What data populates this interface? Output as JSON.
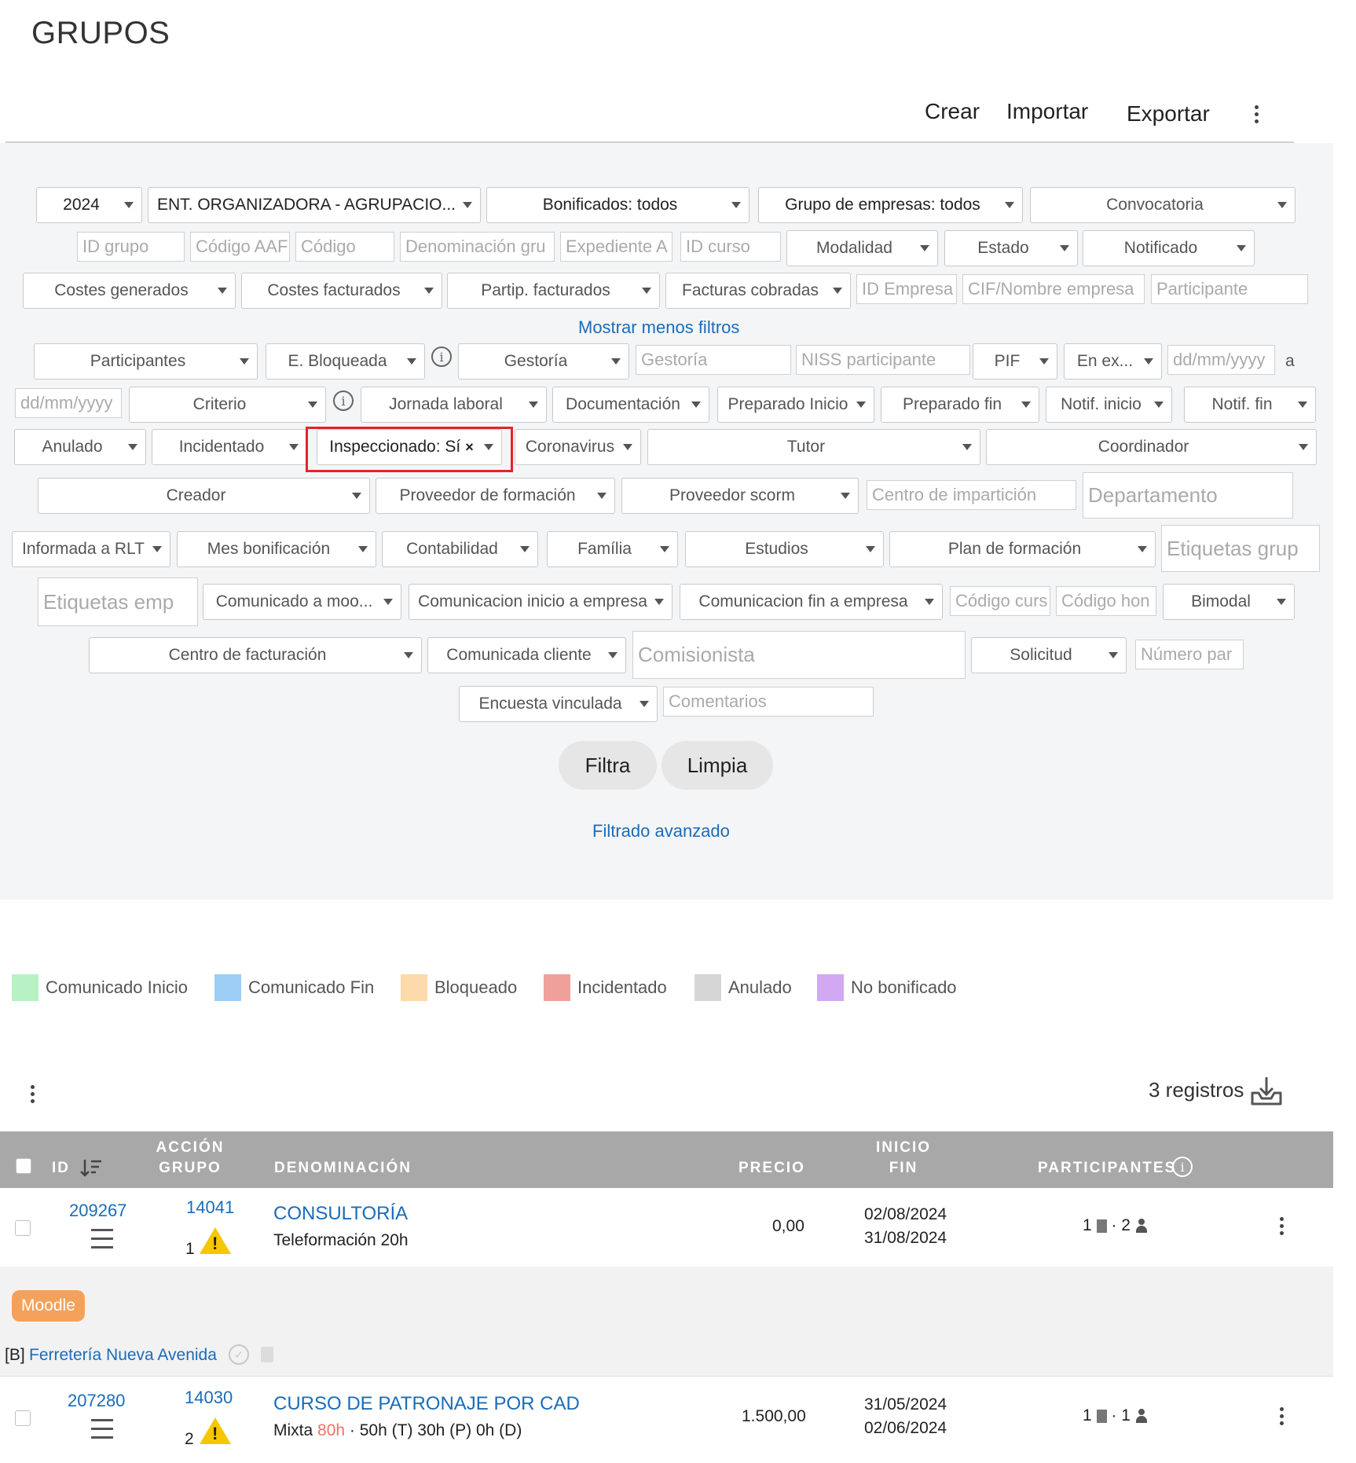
{
  "page": {
    "title": "GRUPOS"
  },
  "toolbar": {
    "create": "Crear",
    "import": "Importar",
    "export": "Exportar"
  },
  "filters": {
    "year": "2024",
    "entity": "ENT. ORGANIZADORA - AGRUPACIO...",
    "bonificados": "Bonificados: todos",
    "grupo_empresas": "Grupo de empresas: todos",
    "convocatoria": "Convocatoria",
    "id_grupo": "ID grupo",
    "codigo_aaf": "Código AAF",
    "codigo": "Código",
    "denominacion": "Denominación gru",
    "expediente": "Expediente A",
    "id_curso": "ID curso",
    "modalidad": "Modalidad",
    "estado": "Estado",
    "notificado": "Notificado",
    "costes_generados": "Costes generados",
    "costes_facturados": "Costes facturados",
    "partip_facturados": "Partip. facturados",
    "facturas_cobradas": "Facturas cobradas",
    "id_empresa": "ID Empresa",
    "cif_nombre": "CIF/Nombre empresa",
    "participante": "Participante",
    "mostrar_menos": "Mostrar menos filtros",
    "participantes": "Participantes",
    "e_bloqueada": "E. Bloqueada",
    "gestoria_select": "Gestoría",
    "gestoria_input": "Gestoría",
    "niss": "NISS participante",
    "pif": "PIF",
    "en_ex": "En ex...",
    "date_from": "dd/mm/yyyy",
    "a": "a",
    "date_to": "dd/mm/yyyy",
    "criterio": "Criterio",
    "jornada": "Jornada laboral",
    "documentacion": "Documentación",
    "preparado_inicio": "Preparado Inicio",
    "preparado_fin": "Preparado fin",
    "notif_inicio": "Notif. inicio",
    "notif_fin": "Notif. fin",
    "anulado": "Anulado",
    "incidentado": "Incidentado",
    "inspeccionado": "Inspeccionado: Sí",
    "clear": "×",
    "coronavirus": "Coronavirus",
    "tutor": "Tutor",
    "coordinador": "Coordinador",
    "creador": "Creador",
    "proveedor_formacion": "Proveedor de formación",
    "proveedor_scorm": "Proveedor scorm",
    "centro_imparticion": "Centro de impartición",
    "departamento": "Departamento",
    "informada_rlt": "Informada a RLT",
    "mes_bonificacion": "Mes bonificación",
    "contabilidad": "Contabilidad",
    "familia": "Família",
    "estudios": "Estudios",
    "plan_formacion": "Plan de formación",
    "etiquetas_grupo": "Etiquetas grup",
    "etiquetas_emp": "Etiquetas emp",
    "comunicado_moo": "Comunicado a moo...",
    "com_inicio_empresa": "Comunicacion inicio a empresa",
    "com_fin_empresa": "Comunicacion fin a empresa",
    "codigo_curso": "Código curs",
    "codigo_hon": "Código hon",
    "bimodal": "Bimodal",
    "centro_facturacion": "Centro de facturación",
    "comunicada_cliente": "Comunicada cliente",
    "comisionista": "Comisionista",
    "solicitud": "Solicitud",
    "numero_par": "Número par",
    "encuesta": "Encuesta vinculada",
    "comentarios": "Comentarios",
    "filtra": "Filtra",
    "limpia": "Limpia",
    "avanzado": "Filtrado avanzado"
  },
  "legend": [
    {
      "label": "Comunicado Inicio",
      "color": "#b8f2c4"
    },
    {
      "label": "Comunicado Fin",
      "color": "#9ccdf4"
    },
    {
      "label": "Bloqueado",
      "color": "#fbd9ab"
    },
    {
      "label": "Incidentado",
      "color": "#f0a09a"
    },
    {
      "label": "Anulado",
      "color": "#d6d6d6"
    },
    {
      "label": "No bonificado",
      "color": "#d2a8f2"
    }
  ],
  "records": "3 registros",
  "table": {
    "headers": {
      "id": "ID",
      "accion": "ACCIÓN",
      "grupo": "GRUPO",
      "denominacion": "DENOMINACIÓN",
      "precio": "PRECIO",
      "inicio": "INICIO",
      "fin": "FIN",
      "participantes": "PARTICIPANTES"
    },
    "rows": [
      {
        "id": "209267",
        "accion": "14041",
        "grupo": "1",
        "denominacion": "CONSULTORÍA",
        "detalle": "Teleformación 20h",
        "precio": "0,00",
        "inicio": "02/08/2024",
        "fin": "31/08/2024",
        "emp_count": "1",
        "part_count": "2"
      },
      {
        "id": "207280",
        "accion": "14030",
        "grupo": "2",
        "denominacion": "CURSO DE PATRONAJE POR CAD",
        "detalle_pre": "Mixta",
        "detalle_hours": "80h",
        "detalle_post": "· 50h (T) 30h (P) 0h (D)",
        "precio": "1.500,00",
        "inicio": "31/05/2024",
        "fin": "02/06/2024",
        "emp_count": "1",
        "part_count": "1"
      }
    ],
    "sub": {
      "badge": "Moodle",
      "prefix": "[B]",
      "company": "Ferretería Nueva Avenida"
    }
  }
}
